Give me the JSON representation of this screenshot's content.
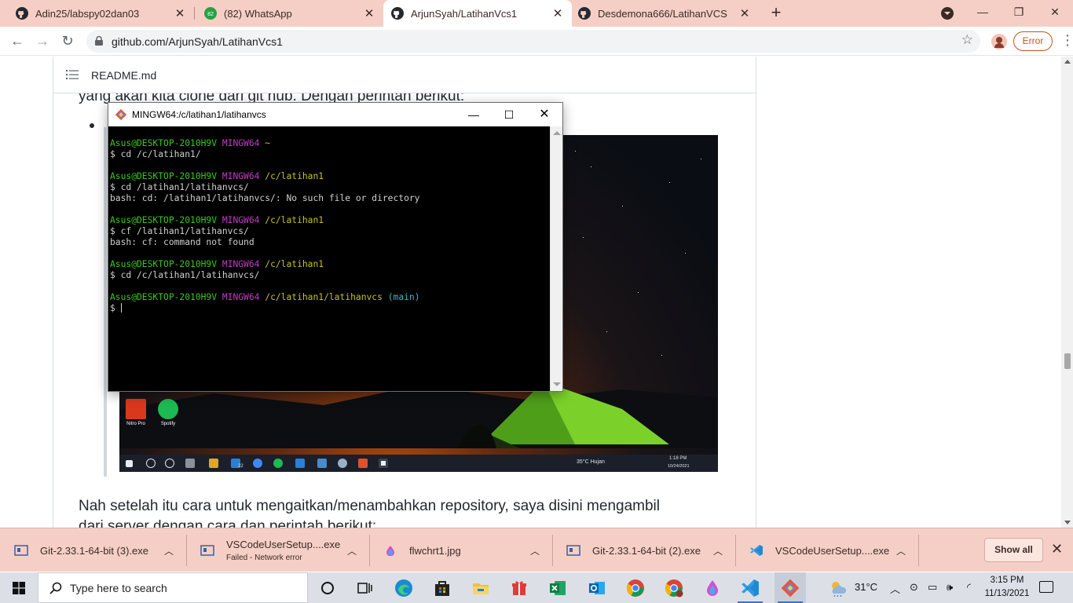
{
  "browser": {
    "tabs": [
      {
        "title": "Adin25/labspy02dan03",
        "icon": "github-icon"
      },
      {
        "title": "(82) WhatsApp",
        "icon": "whatsapp-icon",
        "badge": "82"
      },
      {
        "title": "ArjunSyah/LatihanVcs1",
        "icon": "github-icon",
        "active": true
      },
      {
        "title": "Desdemona666/LatihanVCS",
        "icon": "github-icon"
      }
    ],
    "url": "github.com/ArjunSyah/LatihanVcs1",
    "error_label": "Error",
    "colors": {
      "frame": "#f5cfc5",
      "error": "#c5541e"
    }
  },
  "page": {
    "readme_title": "README.md",
    "text_top": "yang akan kita clone dari git hub. Dengan perintah berikut:",
    "text_bottom_1": "Nah setelah itu cara untuk mengaitkan/menambahkan repository, saya disini mengambil",
    "text_bottom_2": "dari server dengan cara dan perintah berikut:"
  },
  "screenshot": {
    "desktop_icons": [
      {
        "label": "Nitro Pro",
        "color": "#d9381e"
      },
      {
        "label": "Spotify",
        "color": "#1db954"
      }
    ],
    "tray_weather": "35°C  Hujan",
    "tray_time": "1:18 PM",
    "tray_date": "10/24/2021",
    "tray_badge": "22"
  },
  "terminal": {
    "title": "MINGW64:/c/latihan1/latihanvcs",
    "lines": [
      {
        "user": "Asus@DESKTOP-2010H9V",
        "sys": "MINGW64",
        "path": "~",
        "branch": ""
      },
      {
        "out": "$ cd /c/latihan1/"
      },
      {
        "out": ""
      },
      {
        "user": "Asus@DESKTOP-2010H9V",
        "sys": "MINGW64",
        "path": "/c/latihan1",
        "branch": ""
      },
      {
        "out": "$ cd /latihan1/latihanvcs/"
      },
      {
        "out": "bash: cd: /latihan1/latihanvcs/: No such file or directory"
      },
      {
        "out": ""
      },
      {
        "user": "Asus@DESKTOP-2010H9V",
        "sys": "MINGW64",
        "path": "/c/latihan1",
        "branch": ""
      },
      {
        "out": "$ cf /latihan1/latihanvcs/"
      },
      {
        "out": "bash: cf: command not found"
      },
      {
        "out": ""
      },
      {
        "user": "Asus@DESKTOP-2010H9V",
        "sys": "MINGW64",
        "path": "/c/latihan1",
        "branch": ""
      },
      {
        "out": "$ cd /c/latihan1/latihanvcs/"
      },
      {
        "out": ""
      },
      {
        "user": "Asus@DESKTOP-2010H9V",
        "sys": "MINGW64",
        "path": "/c/latihan1/latihanvcs",
        "branch": "(main)"
      },
      {
        "out": "$ ",
        "cursor": true
      }
    ],
    "colors": {
      "user": "#39c81b",
      "sys": "#c53ac9",
      "path": "#c7c11e",
      "branch": "#3bb8c8"
    }
  },
  "downloads": {
    "items": [
      {
        "name": "Git-2.33.1-64-bit (3).exe",
        "status": ""
      },
      {
        "name": "VSCodeUserSetup....exe",
        "status": "Failed - Network error"
      },
      {
        "name": "flwchrt1.jpg",
        "status": ""
      },
      {
        "name": "Git-2.33.1-64-bit (2).exe",
        "status": ""
      },
      {
        "name": "VSCodeUserSetup....exe",
        "status": ""
      }
    ],
    "show_all": "Show all"
  },
  "taskbar": {
    "search_placeholder": "Type here to search",
    "temperature": "31°C",
    "time": "3:15 PM",
    "date": "11/13/2021"
  }
}
